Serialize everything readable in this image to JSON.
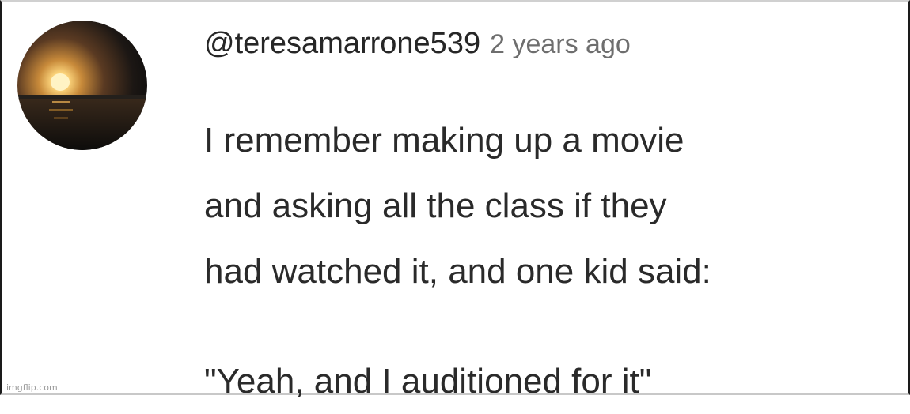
{
  "comment": {
    "author": {
      "handle": "@teresamarrone539",
      "avatar_icon": "sunset-avatar-icon"
    },
    "timestamp": "2 years ago",
    "text_lines": [
      "I remember making up a movie",
      "and asking all the class if they",
      "had watched it, and one kid said:"
    ],
    "quote": "\"Yeah, and I auditioned for it\""
  },
  "watermark": "imgflip.com",
  "colors": {
    "text_primary": "#2a2a2a",
    "text_secondary": "#6e6e6e",
    "background": "#ffffff",
    "sun_glow": "#ffd27a",
    "sky_dark": "#141414"
  }
}
